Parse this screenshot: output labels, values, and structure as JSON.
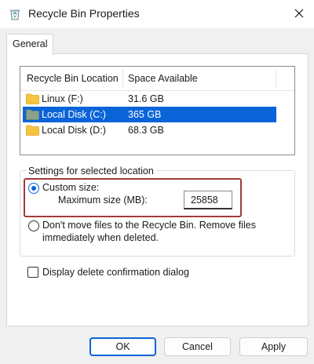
{
  "window": {
    "title": "Recycle Bin Properties"
  },
  "tabs": [
    {
      "label": "General"
    }
  ],
  "listview": {
    "columns": [
      "Recycle Bin Location",
      "Space Available"
    ],
    "rows": [
      {
        "name": "Linux (F:)",
        "space": "31.6 GB",
        "selected": false
      },
      {
        "name": "Local Disk (C:)",
        "space": "365 GB",
        "selected": true
      },
      {
        "name": "Local Disk (D:)",
        "space": "68.3 GB",
        "selected": false
      }
    ]
  },
  "settings": {
    "legend": "Settings for selected location",
    "custom_size_label": "Custom size:",
    "max_size_label": "Maximum size (MB):",
    "max_size_value": "25858",
    "dont_move_label_line1": "Don't move files to the Recycle Bin. Remove files",
    "dont_move_label_line2": "immediately when deleted.",
    "selected_option": "custom_size"
  },
  "confirm_dialog_label": "Display delete confirmation dialog",
  "confirm_dialog_checked": false,
  "buttons": {
    "ok": "OK",
    "cancel": "Cancel",
    "apply": "Apply"
  },
  "icons": {
    "app": "recycle-bin-icon",
    "close": "close-icon",
    "folder": "folder-icon"
  },
  "colors": {
    "accent": "#0a64d8",
    "highlight_border": "#a23a3a",
    "folder": "#f5c542"
  }
}
